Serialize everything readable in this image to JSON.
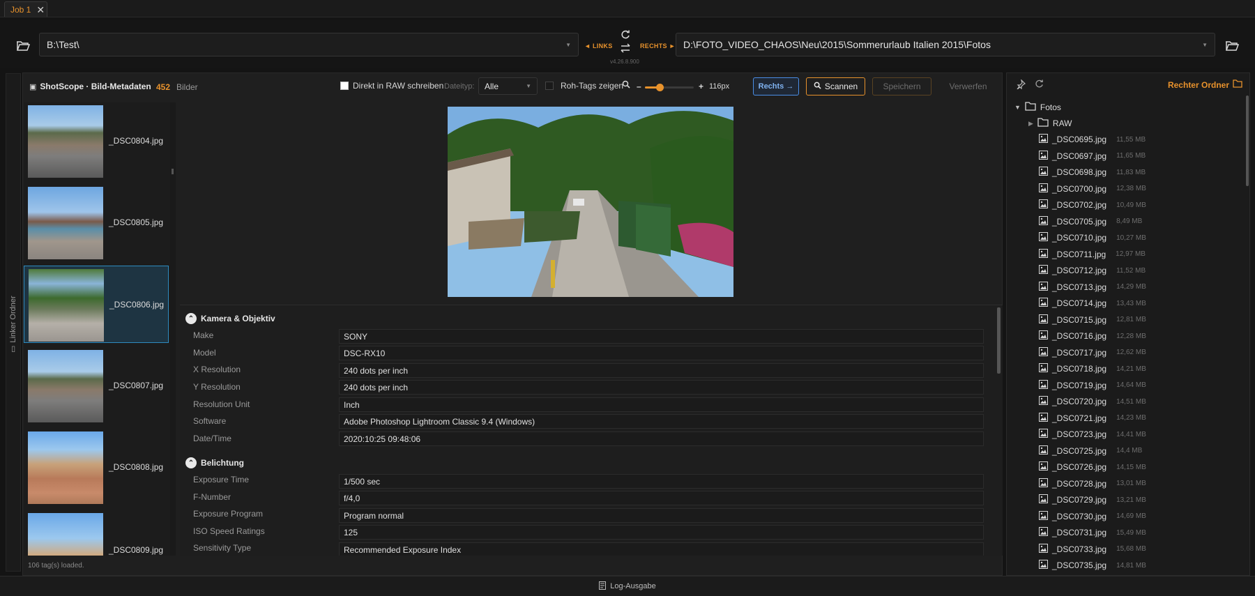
{
  "tab": {
    "label": "Job 1",
    "close": "✕"
  },
  "paths": {
    "left": "B:\\Test\\",
    "right": "D:\\FOTO_VIDEO_CHAOS\\Neu\\2015\\Sommerurlaub Italien 2015\\Fotos",
    "links_label": "◄ LINKS",
    "rechts_label": "RECHTS ►",
    "version": "v4.26.8.900"
  },
  "toolbar": {
    "app_title": "ShotScope · Bild-Metadaten",
    "count": "452",
    "count_unit": "Bilder",
    "raw_checkbox": "Direkt in RAW schreiben",
    "filetype_label": "Dateityp:",
    "filetype_value": "Alle",
    "rawtags_label": "Roh-Tags zeigen",
    "zoom_minus": "–",
    "zoom_plus": "+",
    "zoom_value": "116px",
    "zoom_level": 0.3,
    "btn_rechts": "Rechts →",
    "btn_scan": "Scannen",
    "btn_save": "Speichern",
    "btn_discard": "Verwerfen"
  },
  "left_strip_label": "Linker Ordner",
  "thumbnails": [
    {
      "name": "_DSC0804.jpg",
      "selected": false
    },
    {
      "name": "_DSC0805.jpg",
      "selected": false
    },
    {
      "name": "_DSC0806.jpg",
      "selected": true
    },
    {
      "name": "_DSC0807.jpg",
      "selected": false
    },
    {
      "name": "_DSC0808.jpg",
      "selected": false
    },
    {
      "name": "_DSC0809.jpg",
      "selected": false
    }
  ],
  "metadata": {
    "sections": [
      {
        "title": "Kamera & Objektiv",
        "rows": [
          {
            "k": "Make",
            "v": "SONY"
          },
          {
            "k": "Model",
            "v": "DSC-RX10"
          },
          {
            "k": "X Resolution",
            "v": "240 dots per inch"
          },
          {
            "k": "Y Resolution",
            "v": "240 dots per inch"
          },
          {
            "k": "Resolution Unit",
            "v": "Inch"
          },
          {
            "k": "Software",
            "v": "Adobe Photoshop Lightroom Classic 9.4 (Windows)"
          },
          {
            "k": "Date/Time",
            "v": "2020:10:25 09:48:06"
          }
        ]
      },
      {
        "title": "Belichtung",
        "rows": [
          {
            "k": "Exposure Time",
            "v": "1/500 sec"
          },
          {
            "k": "F-Number",
            "v": "f/4,0"
          },
          {
            "k": "Exposure Program",
            "v": "Program normal"
          },
          {
            "k": "ISO Speed Ratings",
            "v": "125"
          },
          {
            "k": "Sensitivity Type",
            "v": "Recommended Exposure Index"
          }
        ]
      }
    ]
  },
  "status_text": "106 tag(s) loaded.",
  "right_panel": {
    "title": "Rechter Ordner",
    "root": "Fotos",
    "subfolder": "RAW",
    "files": [
      {
        "n": "_DSC0695.jpg",
        "s": "11,55 MB"
      },
      {
        "n": "_DSC0697.jpg",
        "s": "11,65 MB"
      },
      {
        "n": "_DSC0698.jpg",
        "s": "11,83 MB"
      },
      {
        "n": "_DSC0700.jpg",
        "s": "12,38 MB"
      },
      {
        "n": "_DSC0702.jpg",
        "s": "10,49 MB"
      },
      {
        "n": "_DSC0705.jpg",
        "s": "8,49 MB"
      },
      {
        "n": "_DSC0710.jpg",
        "s": "10,27 MB"
      },
      {
        "n": "_DSC0711.jpg",
        "s": "12,97 MB"
      },
      {
        "n": "_DSC0712.jpg",
        "s": "11,52 MB"
      },
      {
        "n": "_DSC0713.jpg",
        "s": "14,29 MB"
      },
      {
        "n": "_DSC0714.jpg",
        "s": "13,43 MB"
      },
      {
        "n": "_DSC0715.jpg",
        "s": "12,81 MB"
      },
      {
        "n": "_DSC0716.jpg",
        "s": "12,28 MB"
      },
      {
        "n": "_DSC0717.jpg",
        "s": "12,62 MB"
      },
      {
        "n": "_DSC0718.jpg",
        "s": "14,21 MB"
      },
      {
        "n": "_DSC0719.jpg",
        "s": "14,64 MB"
      },
      {
        "n": "_DSC0720.jpg",
        "s": "14,51 MB"
      },
      {
        "n": "_DSC0721.jpg",
        "s": "14,23 MB"
      },
      {
        "n": "_DSC0723.jpg",
        "s": "14,41 MB"
      },
      {
        "n": "_DSC0725.jpg",
        "s": "14,4 MB"
      },
      {
        "n": "_DSC0726.jpg",
        "s": "14,15 MB"
      },
      {
        "n": "_DSC0728.jpg",
        "s": "13,01 MB"
      },
      {
        "n": "_DSC0729.jpg",
        "s": "13,21 MB"
      },
      {
        "n": "_DSC0730.jpg",
        "s": "14,69 MB"
      },
      {
        "n": "_DSC0731.jpg",
        "s": "15,49 MB"
      },
      {
        "n": "_DSC0733.jpg",
        "s": "15,68 MB"
      },
      {
        "n": "_DSC0735.jpg",
        "s": "14,81 MB"
      }
    ]
  },
  "log_label": "Log-Ausgabe",
  "colors": {
    "accent": "#e8922c",
    "select_blue": "#2e8bc0",
    "btn_blue": "#4a8ee8"
  },
  "icons": [
    "folder-open-icon",
    "refresh-icon",
    "swap-icon",
    "camera-icon",
    "search-icon",
    "pin-icon",
    "folder-icon",
    "image-file-icon",
    "log-icon",
    "chevron-up-icon"
  ]
}
